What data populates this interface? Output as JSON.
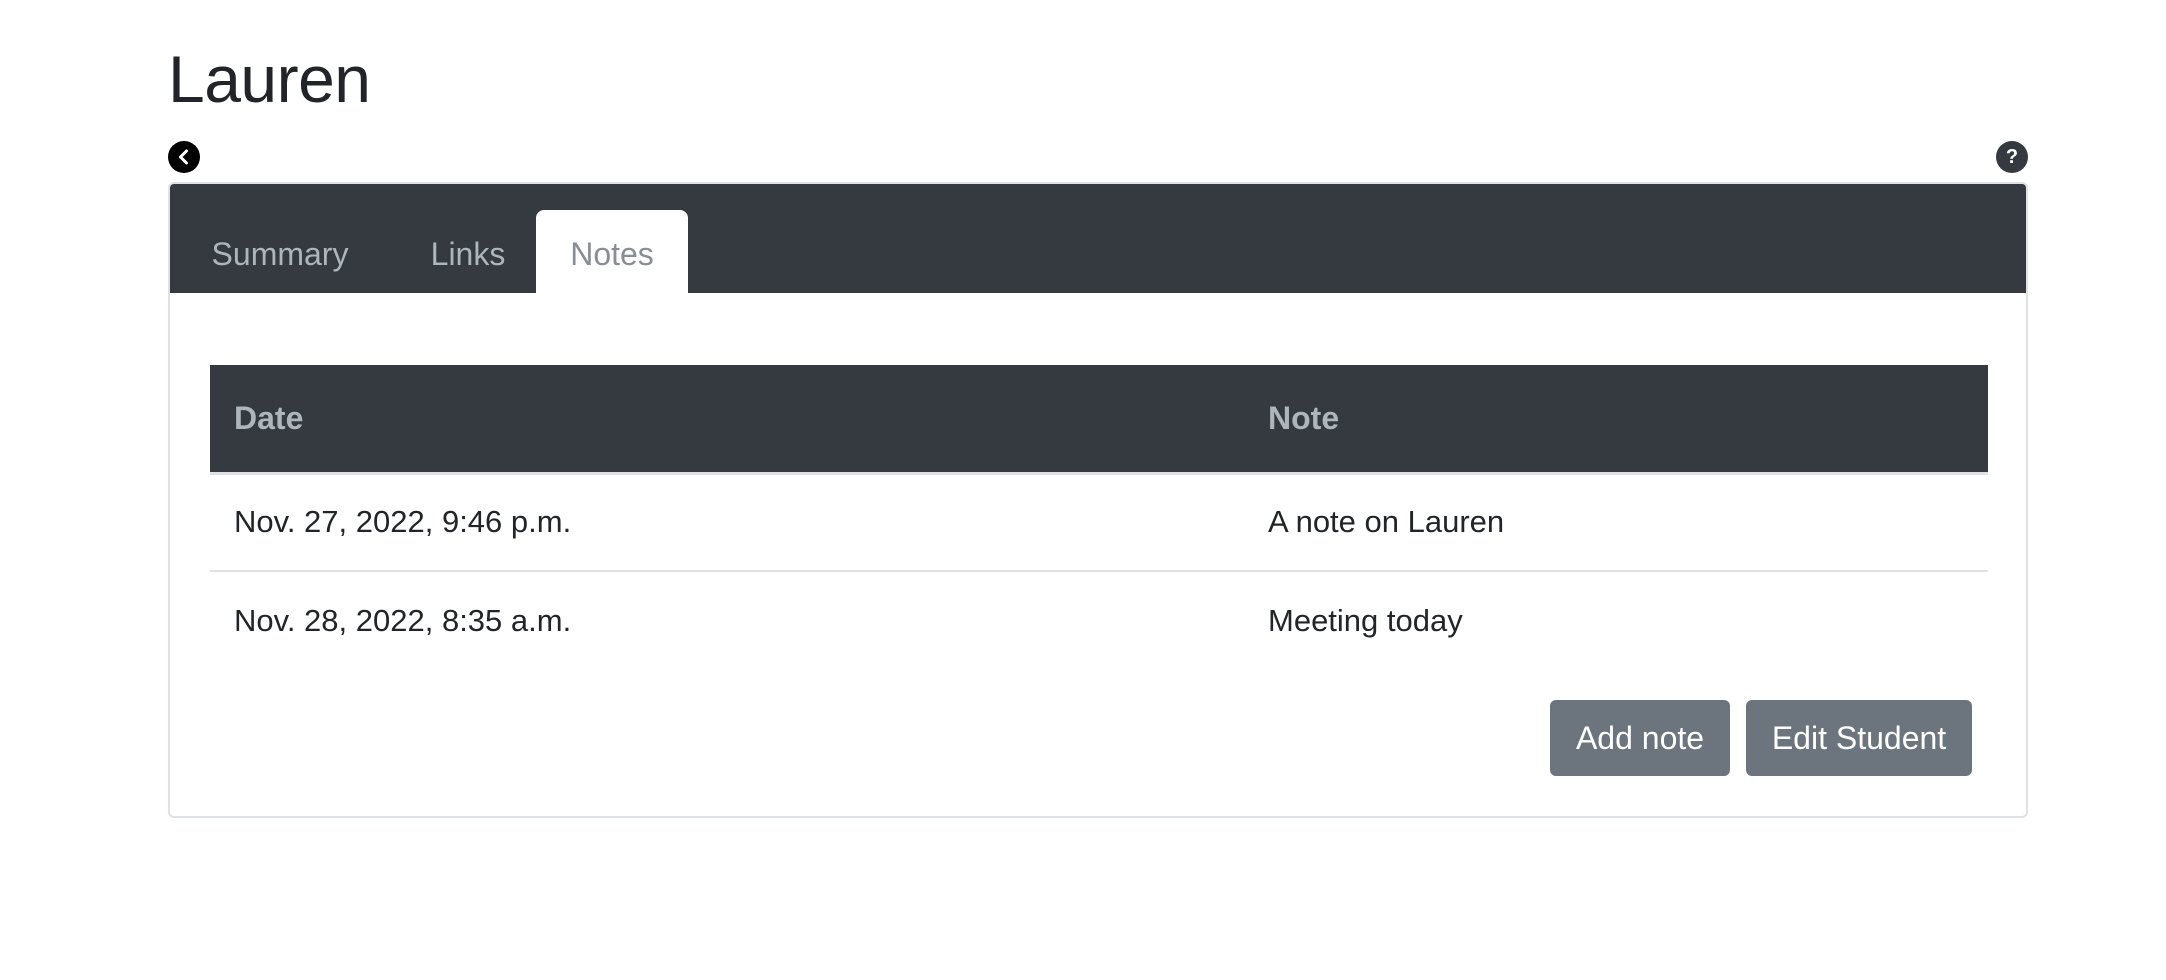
{
  "page": {
    "title": "Lauren"
  },
  "icons": {
    "back": "chevron-left-circle-icon",
    "help": "question-circle-icon",
    "help_glyph": "?"
  },
  "colors": {
    "header_bg": "#343a40",
    "button_bg": "#6c757d",
    "muted_text": "#adb5bd",
    "active_tab_text": "#868e96",
    "border": "#dee2e6"
  },
  "tabs": [
    {
      "label": "Summary",
      "active": false
    },
    {
      "label": "Links",
      "active": false
    },
    {
      "label": "Notes",
      "active": true
    }
  ],
  "notes_table": {
    "columns": [
      "Date",
      "Note"
    ],
    "rows": [
      {
        "date": "Nov. 27, 2022, 9:46 p.m.",
        "note": "A note on Lauren"
      },
      {
        "date": "Nov. 28, 2022, 8:35 a.m.",
        "note": "Meeting today"
      }
    ]
  },
  "actions": {
    "add_note": "Add note",
    "edit_student": "Edit Student"
  }
}
